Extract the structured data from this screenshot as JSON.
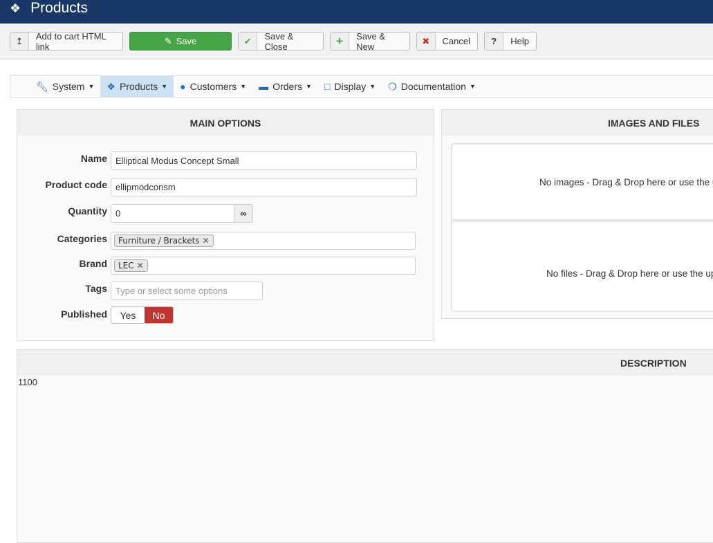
{
  "header": {
    "title": "Products",
    "icon": "cubes-icon"
  },
  "toolbar": {
    "add_cart_link": "Add to cart HTML link",
    "save": "Save",
    "save_close": "Save & Close",
    "save_new": "Save & New",
    "cancel": "Cancel",
    "help": "Help"
  },
  "nav": {
    "items": [
      {
        "label": "System",
        "icon": "wrench-icon"
      },
      {
        "label": "Products",
        "icon": "cubes-icon",
        "active": true
      },
      {
        "label": "Customers",
        "icon": "user-icon"
      },
      {
        "label": "Orders",
        "icon": "credit-card-icon"
      },
      {
        "label": "Display",
        "icon": "monitor-icon"
      },
      {
        "label": "Documentation",
        "icon": "life-ring-icon"
      }
    ]
  },
  "main": {
    "title": "MAIN OPTIONS",
    "name_label": "Name",
    "name_value": "Elliptical Modus Concept Small",
    "code_label": "Product code",
    "code_value": "ellipmodconsm",
    "qty_label": "Quantity",
    "qty_value": "0",
    "categories_label": "Categories",
    "categories": [
      "Furniture / Brackets"
    ],
    "brand_label": "Brand",
    "brand": [
      "LEC"
    ],
    "tags_label": "Tags",
    "tags_placeholder": "Type or select some options",
    "published_label": "Published",
    "yes": "Yes",
    "no": "No",
    "published": false
  },
  "images": {
    "title": "IMAGES AND FILES",
    "no_images": "No images - Drag & Drop here or use the up",
    "no_files": "No files - Drag & Drop here or use the uplo"
  },
  "description": {
    "title": "DESCRIPTION",
    "content": "1100"
  },
  "colors": {
    "header": "#1a3867",
    "save": "#46a546",
    "no_active": "#bd362f",
    "nav_active": "#cde3f3"
  }
}
